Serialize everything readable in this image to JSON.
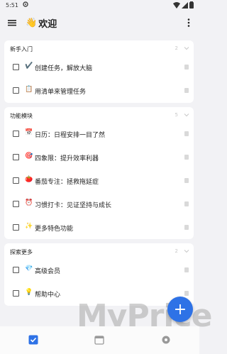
{
  "status_bar": {
    "time": "5:51"
  },
  "app_bar": {
    "title": "欢迎",
    "title_emoji": "👋"
  },
  "sections": [
    {
      "title": "新手入门",
      "count": "2",
      "items": [
        {
          "emoji": "✔️",
          "label": "创建任务，解放大脑"
        },
        {
          "emoji": "📋",
          "label": "用清单来管理任务"
        }
      ]
    },
    {
      "title": "功能模块",
      "count": "5",
      "items": [
        {
          "emoji": "📅",
          "label": "日历：日程安排一目了然"
        },
        {
          "emoji": "🎯",
          "label": "四象限：提升效率利器"
        },
        {
          "emoji": "🍅",
          "label": "番茄专注：拯救拖延症"
        },
        {
          "emoji": "⏰",
          "label": "习惯打卡：见证坚持与成长"
        },
        {
          "emoji": "✨",
          "label": "更多特色功能"
        }
      ]
    },
    {
      "title": "探索更多",
      "count": "2",
      "items": [
        {
          "emoji": "💎",
          "label": "高级会员"
        },
        {
          "emoji": "💡",
          "label": "帮助中心"
        }
      ]
    }
  ],
  "fab": {
    "label": "+"
  },
  "watermark": {
    "big": "MyPrice",
    "small": "myprice.com.cn"
  },
  "colors": {
    "accent": "#2e72e6",
    "background": "#f2f2f5"
  }
}
